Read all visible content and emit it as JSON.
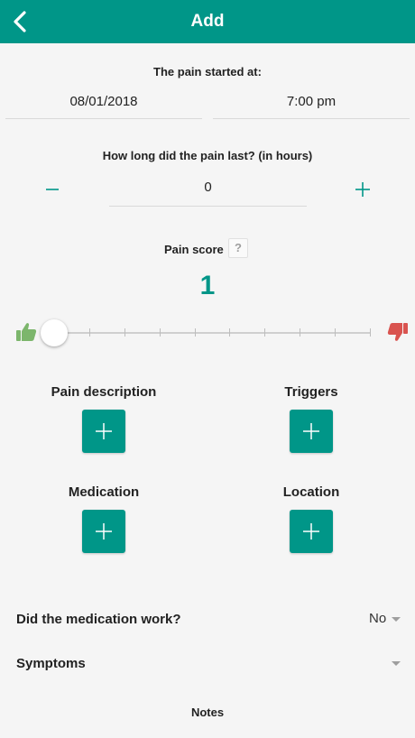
{
  "header": {
    "title": "Add",
    "back_icon": "chevron-left-icon"
  },
  "pain_start": {
    "label": "The pain started at:",
    "date": "08/01/2018",
    "time": "7:00 pm"
  },
  "duration": {
    "label": "How long did the pain last? (in hours)",
    "value": "0",
    "minus": "—",
    "plus": "+"
  },
  "pain_score": {
    "label": "Pain score",
    "help": "?",
    "value": "1",
    "slider_level": 1,
    "slider_min": 1,
    "slider_max": 10,
    "good_icon": "thumbs-up-icon",
    "bad_icon": "thumbs-down-icon"
  },
  "sections": {
    "pain_description": "Pain description",
    "triggers": "Triggers",
    "medication": "Medication",
    "location": "Location"
  },
  "medication_work": {
    "label": "Did the medication work?",
    "value": "No"
  },
  "symptoms": {
    "label": "Symptoms"
  },
  "notes": {
    "label": "Notes"
  },
  "colors": {
    "accent": "#009688",
    "good": "#7cb66c",
    "bad": "#d9534f"
  }
}
